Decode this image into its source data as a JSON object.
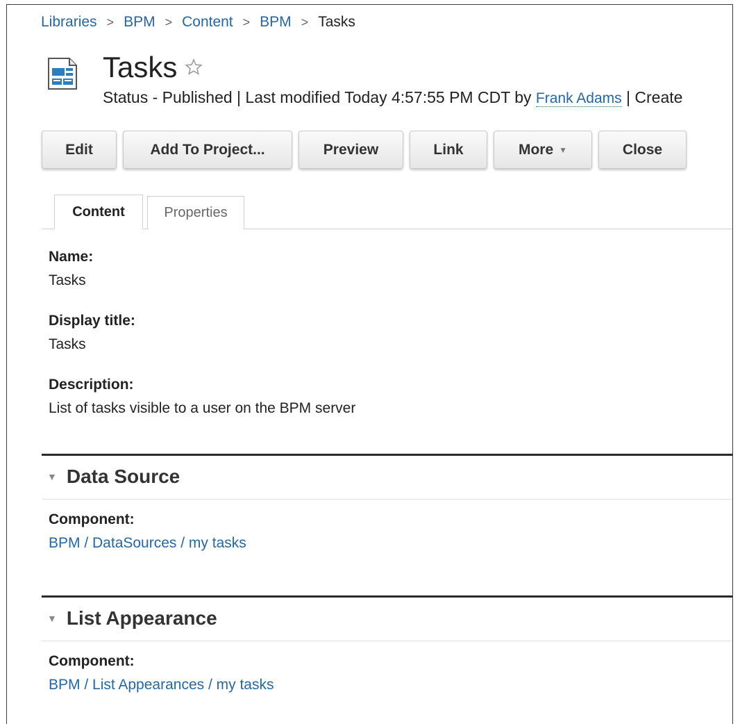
{
  "breadcrumb": {
    "items": [
      "Libraries",
      "BPM",
      "Content",
      "BPM"
    ],
    "current": "Tasks",
    "separator": ">"
  },
  "header": {
    "title": "Tasks",
    "status_prefix": "Status - Published | Last modified Today 4:57:55 PM CDT by ",
    "modified_by": "Frank Adams",
    "status_suffix": " | Create"
  },
  "toolbar": {
    "edit": "Edit",
    "add_to_project": "Add To Project...",
    "preview": "Preview",
    "link": "Link",
    "more": "More",
    "close": "Close"
  },
  "tabs": {
    "content": "Content",
    "properties": "Properties"
  },
  "fields": {
    "name_label": "Name:",
    "name_value": "Tasks",
    "display_title_label": "Display title:",
    "display_title_value": "Tasks",
    "description_label": "Description:",
    "description_value": "List of tasks visible to a user on the BPM server"
  },
  "sections": {
    "data_source": {
      "title": "Data Source",
      "component_label": "Component:",
      "component_value": "BPM / DataSources / my tasks"
    },
    "list_appearance": {
      "title": "List Appearance",
      "component_label": "Component:",
      "component_value": "BPM / List Appearances / my tasks"
    }
  },
  "colors": {
    "link": "#2467a8",
    "icon_blue": "#2a7fc0"
  },
  "icons": {
    "document": "document-icon",
    "star": "star-icon",
    "collapse": "triangle-down-icon",
    "dropdown": "caret-down-icon"
  }
}
